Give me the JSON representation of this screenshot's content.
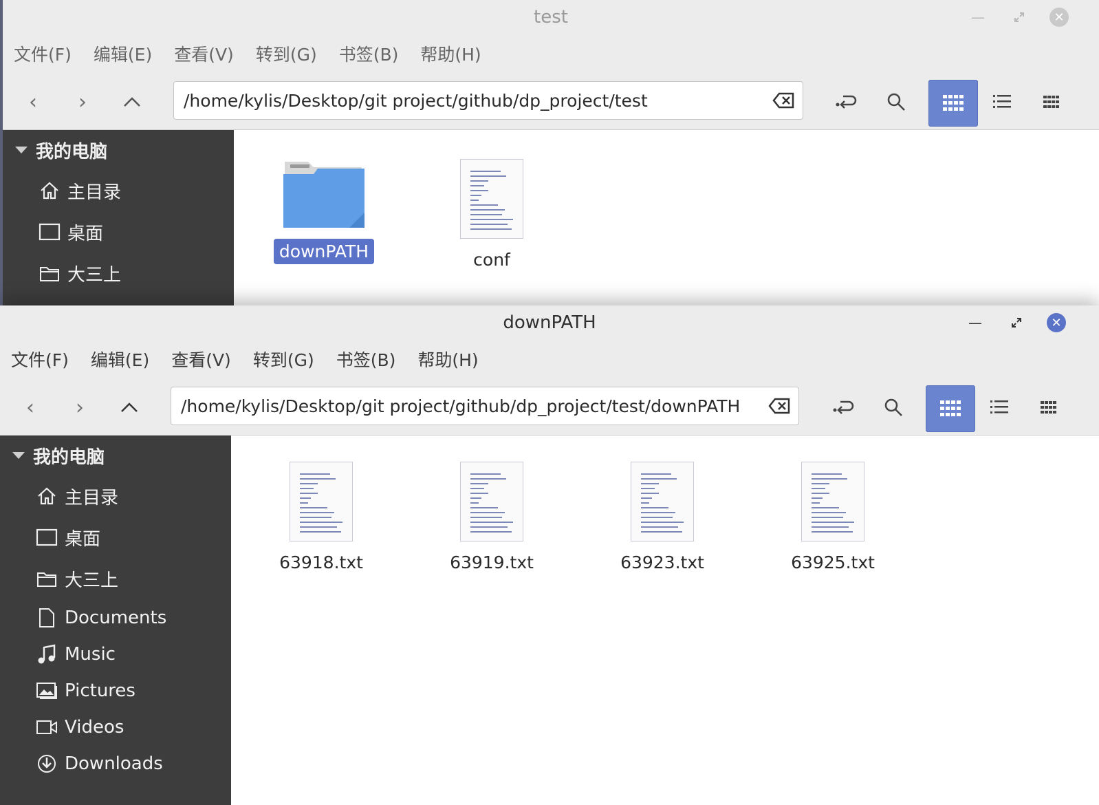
{
  "back_window": {
    "title": "test",
    "menu": [
      "文件(F)",
      "编辑(E)",
      "查看(V)",
      "转到(G)",
      "书签(B)",
      "帮助(H)"
    ],
    "path": "/home/kylis/Desktop/git project/github/dp_project/test",
    "sidebar": {
      "header": "我的电脑",
      "items": [
        {
          "label": "主目录",
          "icon": "home-icon"
        },
        {
          "label": "桌面",
          "icon": "desktop-icon"
        },
        {
          "label": "大三上",
          "icon": "folder-icon"
        }
      ]
    },
    "files": [
      {
        "name": "downPATH",
        "type": "folder",
        "selected": true
      },
      {
        "name": "conf",
        "type": "text-file",
        "selected": false
      }
    ]
  },
  "front_window": {
    "title": "downPATH",
    "menu": [
      "文件(F)",
      "编辑(E)",
      "查看(V)",
      "转到(G)",
      "书签(B)",
      "帮助(H)"
    ],
    "path": "/home/kylis/Desktop/git project/github/dp_project/test/downPATH",
    "sidebar": {
      "header": "我的电脑",
      "items": [
        {
          "label": "主目录",
          "icon": "home-icon"
        },
        {
          "label": "桌面",
          "icon": "desktop-icon"
        },
        {
          "label": "大三上",
          "icon": "folder-icon"
        },
        {
          "label": "Documents",
          "icon": "document-icon"
        },
        {
          "label": "Music",
          "icon": "music-icon"
        },
        {
          "label": "Pictures",
          "icon": "pictures-icon"
        },
        {
          "label": "Videos",
          "icon": "video-icon"
        },
        {
          "label": "Downloads",
          "icon": "download-icon"
        }
      ]
    },
    "files": [
      {
        "name": "63918.txt",
        "type": "text-file"
      },
      {
        "name": "63919.txt",
        "type": "text-file"
      },
      {
        "name": "63923.txt",
        "type": "text-file"
      },
      {
        "name": "63925.txt",
        "type": "text-file"
      }
    ]
  },
  "colors": {
    "accent": "#5a72c8",
    "view_active": "#6b84cf",
    "sidebar_bg": "#3d3d3d",
    "folder": "#5f9de6"
  }
}
